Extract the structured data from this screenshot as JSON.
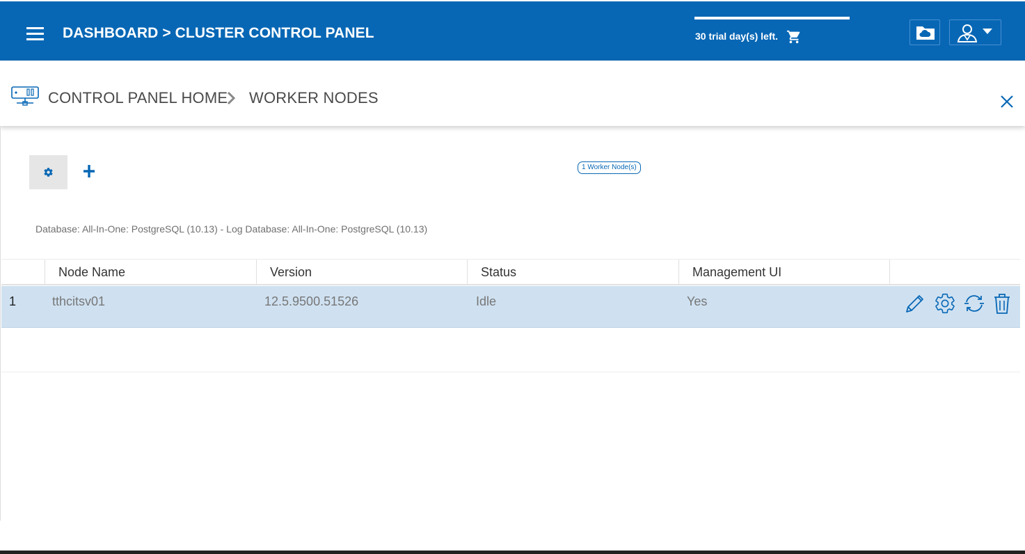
{
  "header": {
    "title": "DASHBOARD > CLUSTER CONTROL PANEL",
    "trial_text": "30 trial day(s) left."
  },
  "breadcrumb": {
    "home": "CONTROL PANEL HOME",
    "current": "WORKER NODES"
  },
  "toolbar": {
    "node_count": "1 Worker Node(s)"
  },
  "database_info": "Database: All-In-One: PostgreSQL (10.13) - Log Database: All-In-One: PostgreSQL (10.13)",
  "table": {
    "columns": [
      "",
      "Node Name",
      "Version",
      "Status",
      "Management UI"
    ],
    "rows": [
      {
        "index": "1",
        "node_name": "tthcitsv01",
        "version": "12.5.9500.51526",
        "status": "Idle",
        "management_ui": "Yes"
      }
    ]
  },
  "icons": {
    "menu": "hamburger-menu-icon",
    "cart": "shopping-cart-icon",
    "cloud": "cloud-folder-icon",
    "user": "user-icon",
    "crumb": "server-network-icon",
    "close": "close-icon",
    "settings": "gear-icon",
    "add": "plus-icon",
    "edit": "pencil-icon",
    "configure": "gear-icon",
    "refresh": "refresh-icon",
    "delete": "trash-icon"
  },
  "colors": {
    "brand": "#0767b5",
    "selected_row": "#cfe1f1"
  }
}
